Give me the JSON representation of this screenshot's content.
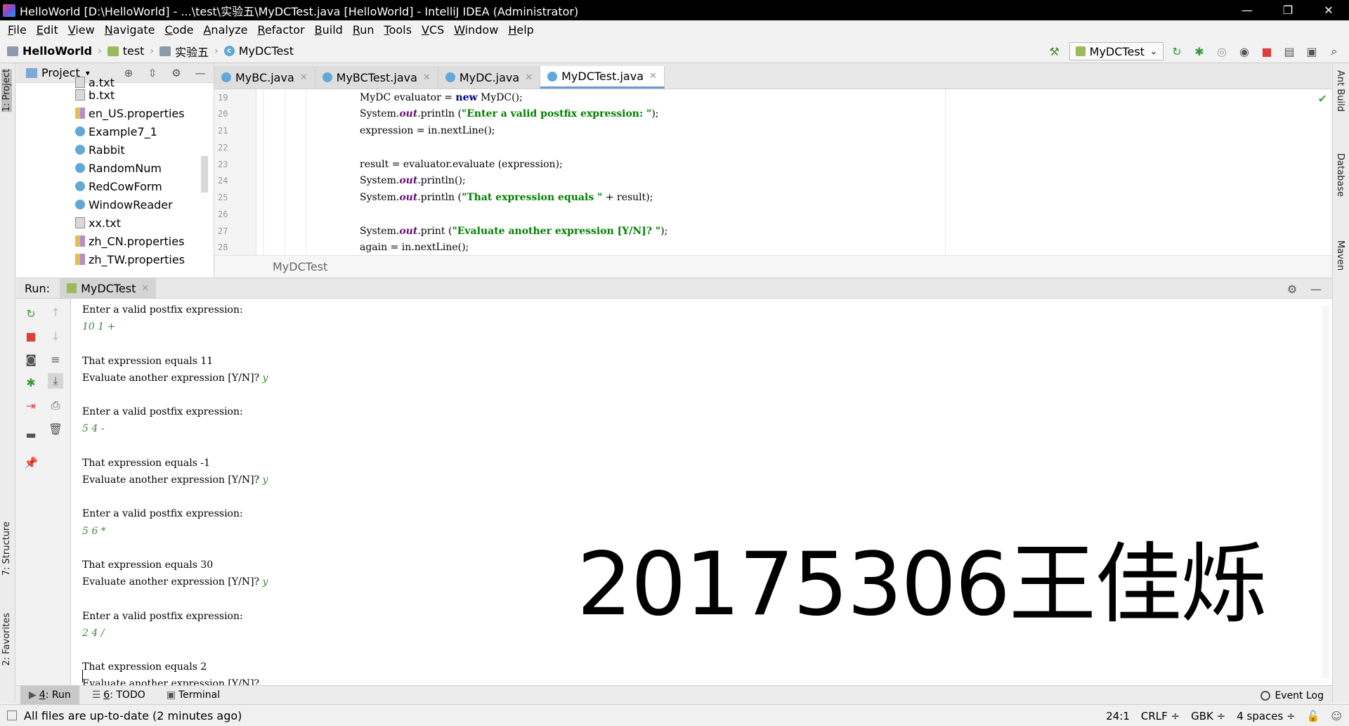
{
  "window": {
    "title": "HelloWorld [D:\\HelloWorld] - ...\\test\\实验五\\MyDCTest.java [HelloWorld] - IntelliJ IDEA (Administrator)",
    "minimize": "—",
    "restore": "❐",
    "close": "✕"
  },
  "menu": [
    "File",
    "Edit",
    "View",
    "Navigate",
    "Code",
    "Analyze",
    "Refactor",
    "Build",
    "Run",
    "Tools",
    "VCS",
    "Window",
    "Help"
  ],
  "nav": {
    "crumbs": [
      "HelloWorld",
      "test",
      "实验五",
      "MyDCTest"
    ],
    "run_config": "MyDCTest"
  },
  "left_strip": {
    "project_tab": "1: Project",
    "structure_tab": "7: Structure",
    "favorites_tab": "2: Favorites"
  },
  "right_strip": {
    "ant": "Ant Build",
    "database": "Database",
    "maven": "Maven"
  },
  "project_panel": {
    "title": "Project",
    "items": [
      "a.txt",
      "b.txt",
      "en_US.properties",
      "Example7_1",
      "Rabbit",
      "RandomNum",
      "RedCowForm",
      "WindowReader",
      "xx.txt",
      "zh_CN.properties",
      "zh_TW.properties"
    ]
  },
  "editor": {
    "tabs": [
      "MyBC.java",
      "MyBCTest.java",
      "MyDC.java",
      "MyDCTest.java"
    ],
    "active_tab": 3,
    "line_numbers": [
      "19",
      "20",
      "21",
      "22",
      "23",
      "24",
      "25",
      "26",
      "27",
      "28"
    ],
    "breadcrumb": "MyDCTest"
  },
  "run_panel": {
    "label": "Run:",
    "tab": "MyDCTest",
    "console": [
      {
        "text": "Enter a valid postfix expression:",
        "input": ""
      },
      {
        "text": "",
        "input": "10 1 +"
      },
      {
        "text": "",
        "input": ""
      },
      {
        "text": "That expression equals 11",
        "input": ""
      },
      {
        "text": "Evaluate another expression [Y/N]? ",
        "input": "y"
      },
      {
        "text": "",
        "input": ""
      },
      {
        "text": "Enter a valid postfix expression:",
        "input": ""
      },
      {
        "text": "",
        "input": "5 4 -"
      },
      {
        "text": "",
        "input": ""
      },
      {
        "text": "That expression equals -1",
        "input": ""
      },
      {
        "text": "Evaluate another expression [Y/N]? ",
        "input": "y"
      },
      {
        "text": "",
        "input": ""
      },
      {
        "text": "Enter a valid postfix expression:",
        "input": ""
      },
      {
        "text": "",
        "input": "5 6 *"
      },
      {
        "text": "",
        "input": ""
      },
      {
        "text": "That expression equals 30",
        "input": ""
      },
      {
        "text": "Evaluate another expression [Y/N]? ",
        "input": "y"
      },
      {
        "text": "",
        "input": ""
      },
      {
        "text": "Enter a valid postfix expression:",
        "input": ""
      },
      {
        "text": "",
        "input": "2 4 /"
      },
      {
        "text": "",
        "input": ""
      },
      {
        "text": "That expression equals 2",
        "input": ""
      },
      {
        "text": "Evaluate another expression [Y/N]?",
        "input": ""
      }
    ],
    "watermark": "20175306王佳烁"
  },
  "bottom_tabs": {
    "run_num": "4",
    "run": ": Run",
    "todo_num": "6",
    "todo": ": TODO",
    "terminal": "Terminal",
    "event_log": "Event Log"
  },
  "status": {
    "message": "All files are up-to-date (2 minutes ago)",
    "position": "24:1",
    "line_sep": "CRLF ÷",
    "encoding": "GBK ÷",
    "indent": "4 spaces ÷"
  },
  "colors": {
    "keyword": "#000080",
    "field": "#660e7a",
    "string": "#008000",
    "user_input": "#3a8a3a"
  }
}
